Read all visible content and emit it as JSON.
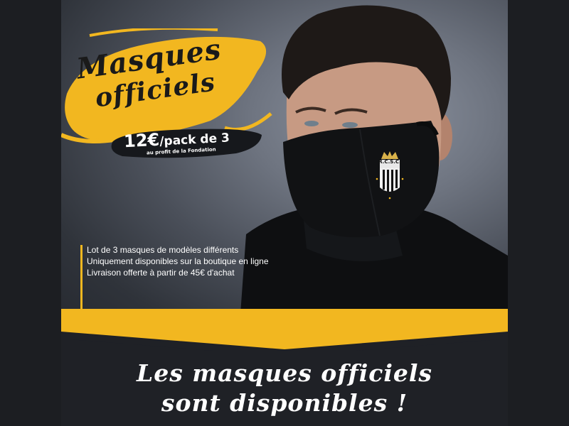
{
  "colors": {
    "accent": "#f2b720",
    "dark": "#1f2126",
    "pill": "#16181c"
  },
  "promo": {
    "title_line1": "Masques",
    "title_line2": "officiels",
    "price": "12€",
    "price_unit": "/pack de 3",
    "fondation_note": "au profit de la Fondation"
  },
  "features": [
    "Lot de 3 masques de modèles différents",
    "Uniquement disponibles sur la boutique en ligne",
    "Livraison offerte à partir de 45€ d'achat"
  ],
  "logo": {
    "text": "R.C.S.C."
  },
  "headline": {
    "line1": "Les masques officiels",
    "line2": "sont disponibles !"
  }
}
